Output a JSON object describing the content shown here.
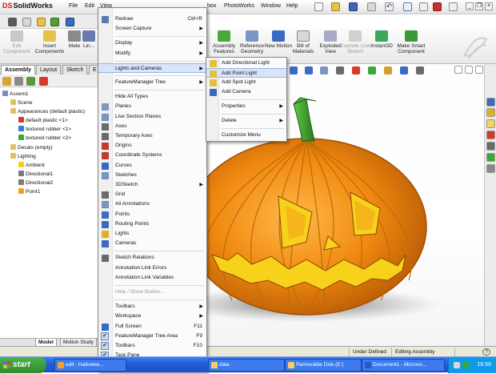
{
  "app": {
    "logo_prefix": "DS",
    "name": "SolidWorks",
    "menubar": [
      "File",
      "Edit",
      "View",
      "box",
      "PhotoWorks",
      "Window",
      "Help"
    ]
  },
  "command_manager": [
    {
      "label": "Edit Component",
      "enabled": false
    },
    {
      "label": "Insert Components",
      "enabled": true
    },
    {
      "label": "Mate",
      "enabled": true
    },
    {
      "label": "Lin...",
      "enabled": true
    },
    {
      "label": "Assembly Features",
      "enabled": true
    },
    {
      "label": "Reference Geometry",
      "enabled": true
    },
    {
      "label": "New Motion",
      "enabled": true
    },
    {
      "label": "Bill of Materials",
      "enabled": true
    },
    {
      "label": "Exploded View",
      "enabled": true
    },
    {
      "label": "Explode Line Sketch",
      "enabled": false
    },
    {
      "label": "Instant3D",
      "enabled": true
    },
    {
      "label": "Make Smart Component",
      "enabled": true
    }
  ],
  "tabs": [
    {
      "label": "Assembly",
      "active": true
    },
    {
      "label": "Layout",
      "active": false
    },
    {
      "label": "Sketch",
      "active": false
    },
    {
      "label": "E",
      "active": false
    }
  ],
  "tree": {
    "items": [
      {
        "label": "Assem1",
        "indent": 0,
        "icon_color": "#7a8fc0"
      },
      {
        "label": "Scene",
        "indent": 1,
        "icon_color": "#e0c060"
      },
      {
        "label": "Appearances (default plastic)",
        "indent": 1,
        "icon_color": "#e0c060"
      },
      {
        "label": "default plastic <1>",
        "indent": 2,
        "icon_color": "#d83a2a"
      },
      {
        "label": "textured rubber <1>",
        "indent": 2,
        "icon_color": "#3a7ad8"
      },
      {
        "label": "textured rubber <2>",
        "indent": 2,
        "icon_color": "#3aa83a"
      },
      {
        "label": "Decals (empty)",
        "indent": 1,
        "icon_color": "#e0c060"
      },
      {
        "label": "Lighting",
        "indent": 1,
        "icon_color": "#e0c060"
      },
      {
        "label": "Ambient",
        "indent": 2,
        "icon_color": "#f2d21a"
      },
      {
        "label": "Directional1",
        "indent": 2,
        "icon_color": "#7a7a7a"
      },
      {
        "label": "Directional2",
        "indent": 2,
        "icon_color": "#7a7a7a"
      },
      {
        "label": "Point1",
        "indent": 2,
        "icon_color": "#f2a21a"
      }
    ]
  },
  "bottom_tabs": [
    {
      "label": "Model",
      "active": true
    },
    {
      "label": "Motion Study",
      "active": false
    }
  ],
  "status": {
    "state": "Under Defined",
    "mode": "Editing Assembly",
    "help": "?"
  },
  "menu": {
    "items": [
      {
        "label": "Redraw",
        "shortcut": "Ctrl+R",
        "icon": "redraw-icon",
        "color": "#5a7ab0"
      },
      {
        "label": "Screen Capture",
        "arrow": true
      },
      {
        "sep": true
      },
      {
        "label": "Display",
        "arrow": true
      },
      {
        "label": "Modify",
        "arrow": true
      },
      {
        "sep": true
      },
      {
        "label": "Lights and Cameras",
        "arrow": true,
        "highlighted": true
      },
      {
        "sep": true
      },
      {
        "label": "FeatureManager Tree",
        "arrow": true
      },
      {
        "sep": true
      },
      {
        "label": "Hide All Types"
      },
      {
        "label": "Planes",
        "icon": "planes-icon",
        "color": "#7d95c2"
      },
      {
        "label": "Live Section Planes",
        "icon": "live-section-icon",
        "color": "#7d95c2",
        "checked_box": true
      },
      {
        "label": "Axes",
        "icon": "axes-icon",
        "color": "#6a6a6a"
      },
      {
        "label": "Temporary Axes",
        "icon": "temp-axes-icon",
        "color": "#6a6a6a"
      },
      {
        "label": "Origins",
        "icon": "origins-icon",
        "color": "#c23a2a"
      },
      {
        "label": "Coordinate Systems",
        "icon": "coord-icon",
        "color": "#c23a2a"
      },
      {
        "label": "Curves",
        "icon": "curves-icon",
        "color": "#3a6ac2"
      },
      {
        "label": "Sketches",
        "icon": "sketches-icon",
        "color": "#7d95c2",
        "checked_box": true
      },
      {
        "label": "3DSketch",
        "arrow": true
      },
      {
        "label": "Grid",
        "icon": "grid-icon",
        "color": "#6a6a6a"
      },
      {
        "label": "All Annotations",
        "icon": "annotations-icon",
        "color": "#7d95c2",
        "checked_box": true
      },
      {
        "label": "Points",
        "icon": "points-icon",
        "color": "#3a6ac2"
      },
      {
        "label": "Routing Points",
        "icon": "routing-icon",
        "color": "#3a6ac2"
      },
      {
        "label": "Lights",
        "icon": "lights-icon",
        "color": "#e0b020"
      },
      {
        "label": "Cameras",
        "icon": "cameras-icon",
        "color": "#3a6ac2"
      },
      {
        "sep": true
      },
      {
        "label": "Sketch Relations",
        "icon": "relations-icon",
        "color": "#6a6a6a"
      },
      {
        "label": "Annotation Link Errors"
      },
      {
        "label": "Annotation Link Variables"
      },
      {
        "sep": true
      },
      {
        "label": "Hide / Show Bodies...",
        "disabled": true
      },
      {
        "sep": true
      },
      {
        "label": "Toolbars",
        "arrow": true
      },
      {
        "label": "Workspace",
        "arrow": true
      },
      {
        "label": "Full Screen",
        "shortcut": "F11",
        "icon": "fullscreen-icon",
        "color": "#3a6ac2"
      },
      {
        "label": "FeatureManager Tree Area",
        "shortcut": "F9",
        "checked": true
      },
      {
        "label": "Toolbars",
        "shortcut": "F10",
        "checked": true
      },
      {
        "label": "Task Pane",
        "checked": true
      },
      {
        "label": "MotionManager",
        "checked": true
      }
    ],
    "more_arrow": "▼"
  },
  "submenu": {
    "items": [
      {
        "label": "Add Directional Light",
        "icon": "directional-light-icon",
        "color": "#e0c040"
      },
      {
        "label": "Add Point Light",
        "icon": "point-light-icon",
        "color": "#e0c040",
        "highlighted": true
      },
      {
        "label": "Add Spot Light",
        "icon": "spot-light-icon",
        "color": "#e0c040"
      },
      {
        "label": "Add Camera",
        "icon": "camera-icon",
        "color": "#3a6ac2"
      },
      {
        "sep": true
      },
      {
        "label": "Properties",
        "arrow": true
      },
      {
        "sep": true
      },
      {
        "label": "Delete",
        "arrow": true
      },
      {
        "sep": true
      },
      {
        "label": "Customize Menu"
      }
    ]
  },
  "taskbar": {
    "start": "start",
    "tasks": [
      {
        "label": "edit : Hallowee...",
        "color": "#f0a030"
      },
      {
        "label": "data",
        "color": "#f4d060"
      },
      {
        "label": "Removable Disk (E:)",
        "color": "#f4d060"
      },
      {
        "label": "Document1 - Microso...",
        "color": "#2a5ac8"
      }
    ],
    "clock": "16:56"
  },
  "colors": {
    "pumpkin": "#f08a10",
    "pumpkin_dark": "#b85a05",
    "stem": "#3aa02a",
    "menu_highlight": "#d8e4f8",
    "taskbar": "#245edb"
  }
}
